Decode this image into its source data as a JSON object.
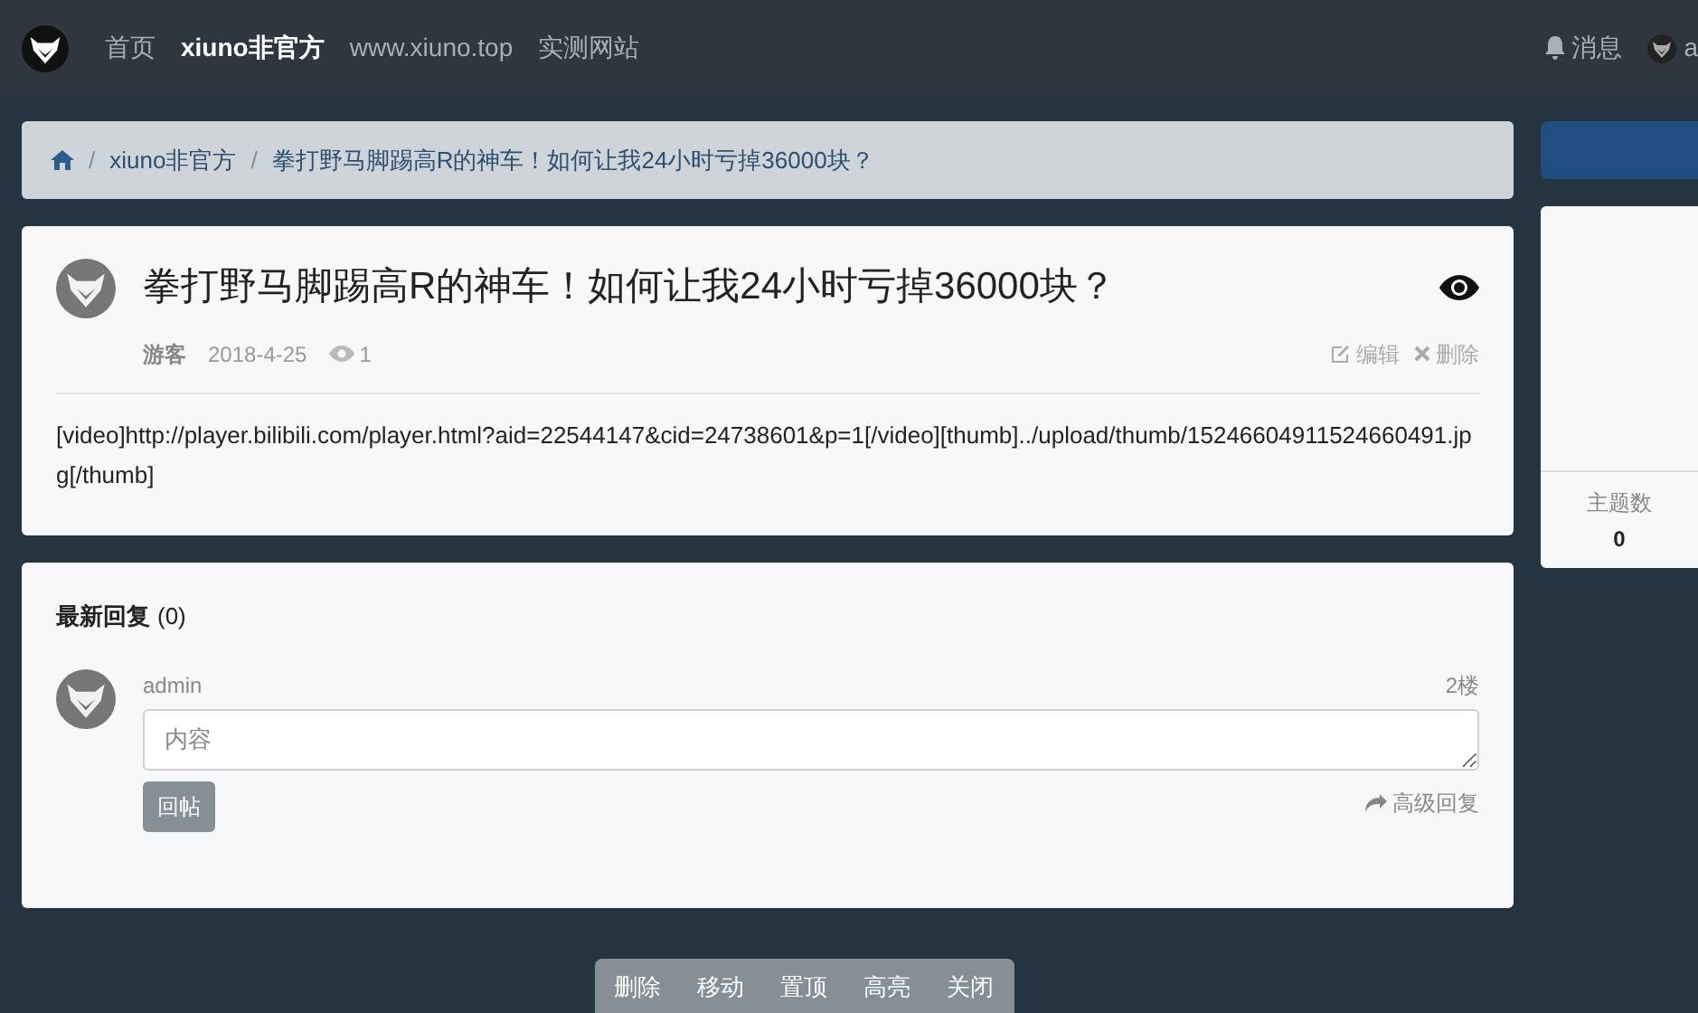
{
  "navbar": {
    "links": [
      {
        "label": "首页",
        "selected": false
      },
      {
        "label": "xiuno非官方",
        "selected": true
      },
      {
        "label": "www.xiuno.top",
        "selected": false
      },
      {
        "label": "实测网站",
        "selected": false
      }
    ],
    "messages": "消息",
    "user": "a"
  },
  "breadcrumb": [
    {
      "separator": "/",
      "label": "xiuno非官方"
    },
    {
      "separator": "/",
      "label": "拳打野马脚踢高R的神车！如何让我24小时亏掉36000块？"
    }
  ],
  "post": {
    "title": "拳打野马脚踢高R的神车！如何让我24小时亏掉36000块？",
    "author": "游客",
    "date": "2018-4-25",
    "views": "1",
    "actions": [
      "编辑",
      "删除"
    ],
    "body": "[video]http://player.bilibili.com/player.html?aid=22544147&cid=24738601&p=1[/video][thumb]../upload/thumb/15246604911524660491.jpg[/thumb]"
  },
  "replies": {
    "heading": "最新回复",
    "count": "(0)",
    "user": "admin",
    "floor": "2楼",
    "placeholder": "内容",
    "submit": "回帖",
    "advanced": "高级回复"
  },
  "sidebar": {
    "stats": [
      {
        "label": "主题数",
        "value": "0"
      }
    ]
  },
  "toolbar": [
    "删除",
    "移动",
    "置顶",
    "高亮",
    "关闭"
  ]
}
